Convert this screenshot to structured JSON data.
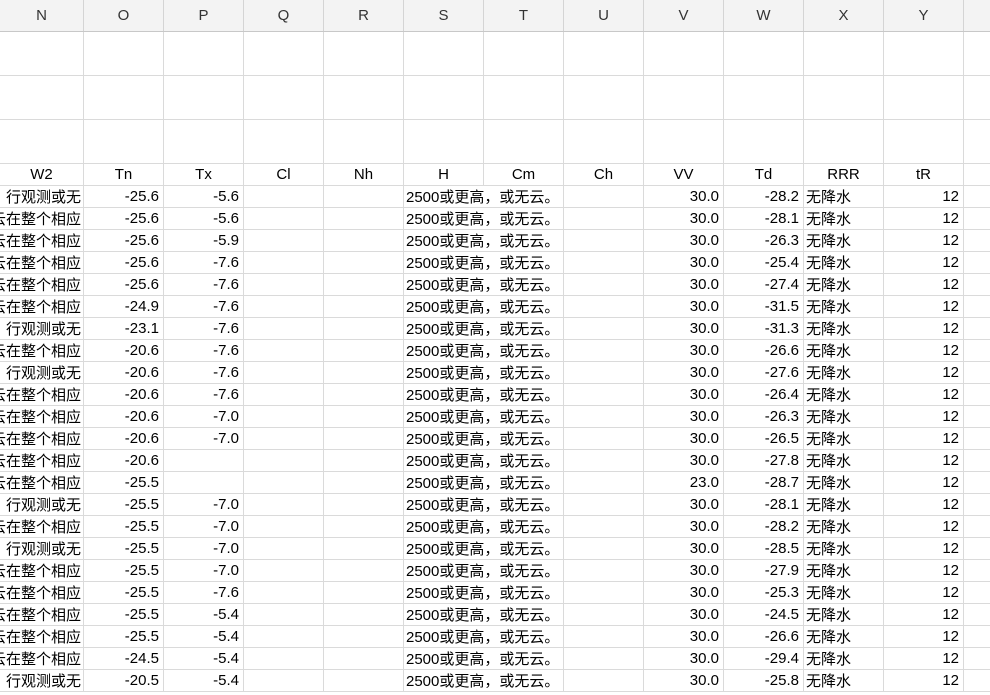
{
  "sheet": {
    "columns": [
      "N",
      "O",
      "P",
      "Q",
      "R",
      "S",
      "T",
      "U",
      "V",
      "W",
      "X",
      "Y"
    ],
    "header_row": {
      "W2": "W2",
      "Tn": "Tn",
      "Tx": "Tx",
      "Cl": "Cl",
      "Nh": "Nh",
      "H": "H",
      "Cm": "Cm",
      "Ch": "Ch",
      "VV": "VV",
      "Td": "Td",
      "RRR": "RRR",
      "tR": "tR"
    },
    "rows": [
      {
        "W2": "行观测或无",
        "Tn": "-25.6",
        "Tx": "-5.6",
        "H": "2500或更高，或无云。",
        "VV": "30.0",
        "Td": "-28.2",
        "RRR": "无降水",
        "tR": "12"
      },
      {
        "W2": "云在整个相应",
        "Tn": "-25.6",
        "Tx": "-5.6",
        "H": "2500或更高，或无云。",
        "VV": "30.0",
        "Td": "-28.1",
        "RRR": "无降水",
        "tR": "12"
      },
      {
        "W2": "云在整个相应",
        "Tn": "-25.6",
        "Tx": "-5.9",
        "H": "2500或更高，或无云。",
        "VV": "30.0",
        "Td": "-26.3",
        "RRR": "无降水",
        "tR": "12"
      },
      {
        "W2": "云在整个相应",
        "Tn": "-25.6",
        "Tx": "-7.6",
        "H": "2500或更高，或无云。",
        "VV": "30.0",
        "Td": "-25.4",
        "RRR": "无降水",
        "tR": "12"
      },
      {
        "W2": "云在整个相应",
        "Tn": "-25.6",
        "Tx": "-7.6",
        "H": "2500或更高，或无云。",
        "VV": "30.0",
        "Td": "-27.4",
        "RRR": "无降水",
        "tR": "12"
      },
      {
        "W2": "云在整个相应",
        "Tn": "-24.9",
        "Tx": "-7.6",
        "H": "2500或更高，或无云。",
        "VV": "30.0",
        "Td": "-31.5",
        "RRR": "无降水",
        "tR": "12"
      },
      {
        "W2": "行观测或无",
        "Tn": "-23.1",
        "Tx": "-7.6",
        "H": "2500或更高，或无云。",
        "VV": "30.0",
        "Td": "-31.3",
        "RRR": "无降水",
        "tR": "12"
      },
      {
        "W2": "云在整个相应",
        "Tn": "-20.6",
        "Tx": "-7.6",
        "H": "2500或更高，或无云。",
        "VV": "30.0",
        "Td": "-26.6",
        "RRR": "无降水",
        "tR": "12"
      },
      {
        "W2": "行观测或无",
        "Tn": "-20.6",
        "Tx": "-7.6",
        "H": "2500或更高，或无云。",
        "VV": "30.0",
        "Td": "-27.6",
        "RRR": "无降水",
        "tR": "12"
      },
      {
        "W2": "云在整个相应",
        "Tn": "-20.6",
        "Tx": "-7.6",
        "H": "2500或更高，或无云。",
        "VV": "30.0",
        "Td": "-26.4",
        "RRR": "无降水",
        "tR": "12"
      },
      {
        "W2": "云在整个相应",
        "Tn": "-20.6",
        "Tx": "-7.0",
        "H": "2500或更高，或无云。",
        "VV": "30.0",
        "Td": "-26.3",
        "RRR": "无降水",
        "tR": "12"
      },
      {
        "W2": "云在整个相应",
        "Tn": "-20.6",
        "Tx": "-7.0",
        "H": "2500或更高，或无云。",
        "VV": "30.0",
        "Td": "-26.5",
        "RRR": "无降水",
        "tR": "12"
      },
      {
        "W2": "云在整个相应",
        "Tn": "-20.6",
        "Tx": "",
        "H": "2500或更高，或无云。",
        "VV": "30.0",
        "Td": "-27.8",
        "RRR": "无降水",
        "tR": "12"
      },
      {
        "W2": "云在整个相应",
        "Tn": "-25.5",
        "Tx": "",
        "H": "2500或更高，或无云。",
        "VV": "23.0",
        "Td": "-28.7",
        "RRR": "无降水",
        "tR": "12"
      },
      {
        "W2": "行观测或无",
        "Tn": "-25.5",
        "Tx": "-7.0",
        "H": "2500或更高，或无云。",
        "VV": "30.0",
        "Td": "-28.1",
        "RRR": "无降水",
        "tR": "12"
      },
      {
        "W2": "云在整个相应",
        "Tn": "-25.5",
        "Tx": "-7.0",
        "H": "2500或更高，或无云。",
        "VV": "30.0",
        "Td": "-28.2",
        "RRR": "无降水",
        "tR": "12"
      },
      {
        "W2": "行观测或无",
        "Tn": "-25.5",
        "Tx": "-7.0",
        "H": "2500或更高，或无云。",
        "VV": "30.0",
        "Td": "-28.5",
        "RRR": "无降水",
        "tR": "12"
      },
      {
        "W2": "云在整个相应",
        "Tn": "-25.5",
        "Tx": "-7.0",
        "H": "2500或更高，或无云。",
        "VV": "30.0",
        "Td": "-27.9",
        "RRR": "无降水",
        "tR": "12"
      },
      {
        "W2": "云在整个相应",
        "Tn": "-25.5",
        "Tx": "-7.6",
        "H": "2500或更高，或无云。",
        "VV": "30.0",
        "Td": "-25.3",
        "RRR": "无降水",
        "tR": "12"
      },
      {
        "W2": "云在整个相应",
        "Tn": "-25.5",
        "Tx": "-5.4",
        "H": "2500或更高，或无云。",
        "VV": "30.0",
        "Td": "-24.5",
        "RRR": "无降水",
        "tR": "12"
      },
      {
        "W2": "云在整个相应",
        "Tn": "-25.5",
        "Tx": "-5.4",
        "H": "2500或更高，或无云。",
        "VV": "30.0",
        "Td": "-26.6",
        "RRR": "无降水",
        "tR": "12"
      },
      {
        "W2": "云在整个相应",
        "Tn": "-24.5",
        "Tx": "-5.4",
        "H": "2500或更高，或无云。",
        "VV": "30.0",
        "Td": "-29.4",
        "RRR": "无降水",
        "tR": "12"
      },
      {
        "W2": "行观测或无",
        "Tn": "-20.5",
        "Tx": "-5.4",
        "H": "2500或更高，或无云。",
        "VV": "30.0",
        "Td": "-25.8",
        "RRR": "无降水",
        "tR": "12"
      }
    ]
  }
}
